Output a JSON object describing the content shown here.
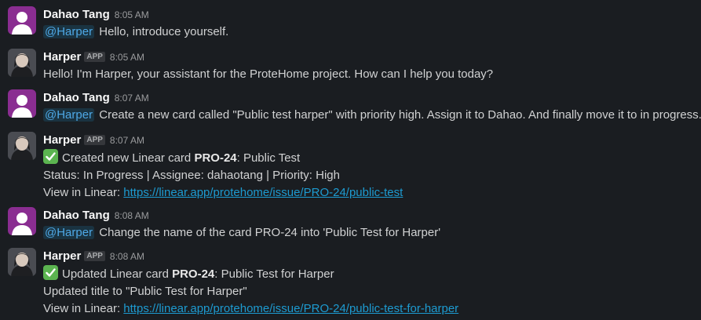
{
  "messages": [
    {
      "author": "Dahao Tang",
      "time": "8:05 AM",
      "mention": "@Harper",
      "text": "Hello, introduce yourself."
    },
    {
      "author": "Harper",
      "badge": "APP",
      "time": "8:05 AM",
      "text": "Hello! I'm Harper, your assistant for the ProteHome project. How can I help you today?"
    },
    {
      "author": "Dahao Tang",
      "time": "8:07 AM",
      "mention": "@Harper",
      "text": "Create a new card called \"Public test harper\" with priority high. Assign it to Dahao. And finally move it to in progress."
    },
    {
      "author": "Harper",
      "badge": "APP",
      "time": "8:07 AM",
      "line1_prefix": "Created new Linear card ",
      "line1_card": "PRO-24",
      "line1_suffix": ": Public Test",
      "line2": "Status: In Progress | Assignee: dahaotang | Priority: High",
      "line3_prefix": "View in Linear: ",
      "line3_link": "https://linear.app/protehome/issue/PRO-24/public-test"
    },
    {
      "author": "Dahao Tang",
      "time": "8:08 AM",
      "mention": "@Harper",
      "text": "Change the name of the card PRO-24 into 'Public Test for Harper'"
    },
    {
      "author": "Harper",
      "badge": "APP",
      "time": "8:08 AM",
      "line1_prefix": "Updated Linear card ",
      "line1_card": "PRO-24",
      "line1_suffix": ": Public Test for Harper",
      "line2": "Updated title to \"Public Test for Harper\"",
      "line3_prefix": "View in Linear: ",
      "line3_link": "https://linear.app/protehome/issue/PRO-24/public-test-for-harper"
    }
  ],
  "colors": {
    "background": "#1a1d21",
    "user_avatar": "#8a2d91",
    "mention": "#4ea8e6",
    "link": "#1d9bd1",
    "check": "#5bb450"
  },
  "icons": {
    "user_avatar": "default-user-icon",
    "bot_avatar": "harper-portrait",
    "status": "white-check-mark-icon"
  }
}
